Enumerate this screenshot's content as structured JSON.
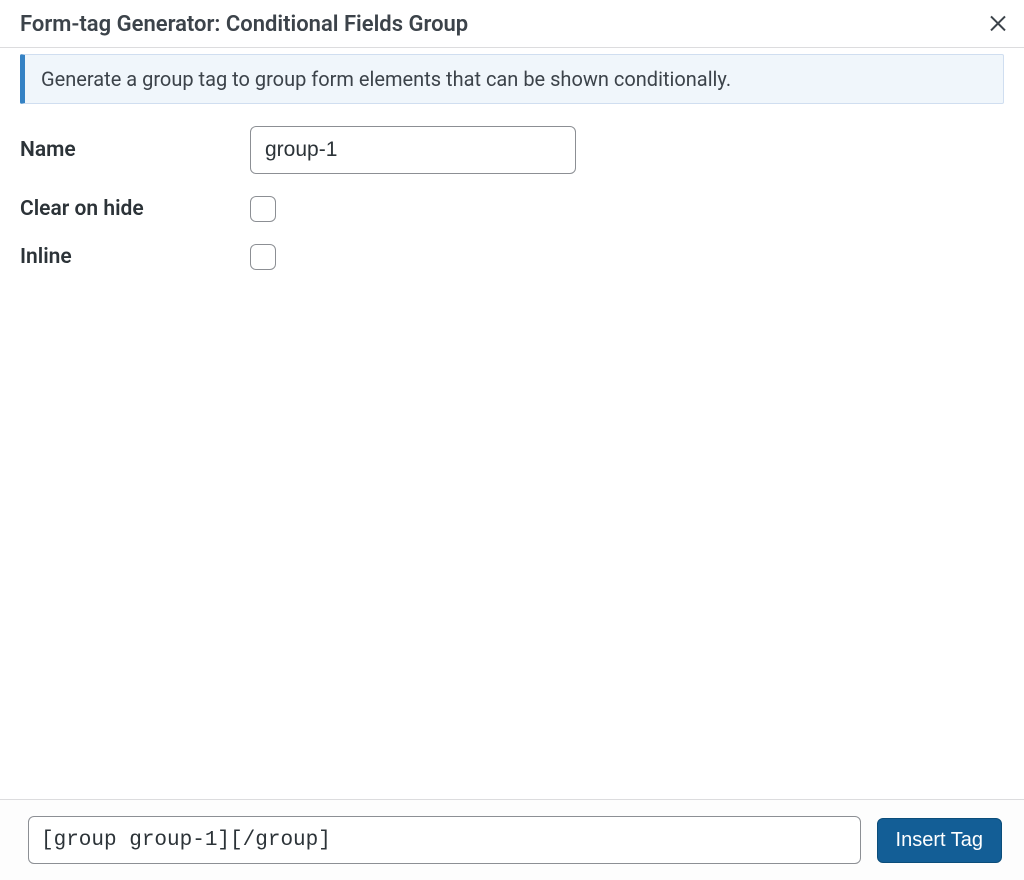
{
  "header": {
    "title": "Form-tag Generator: Conditional Fields Group"
  },
  "banner": {
    "text": "Generate a group tag to group form elements that can be shown conditionally."
  },
  "fields": {
    "name_label": "Name",
    "name_value": "group-1",
    "clear_label": "Clear on hide",
    "clear_checked": false,
    "inline_label": "Inline",
    "inline_checked": false
  },
  "footer": {
    "tag_value": "[group group-1][/group]",
    "button_label": "Insert Tag"
  }
}
